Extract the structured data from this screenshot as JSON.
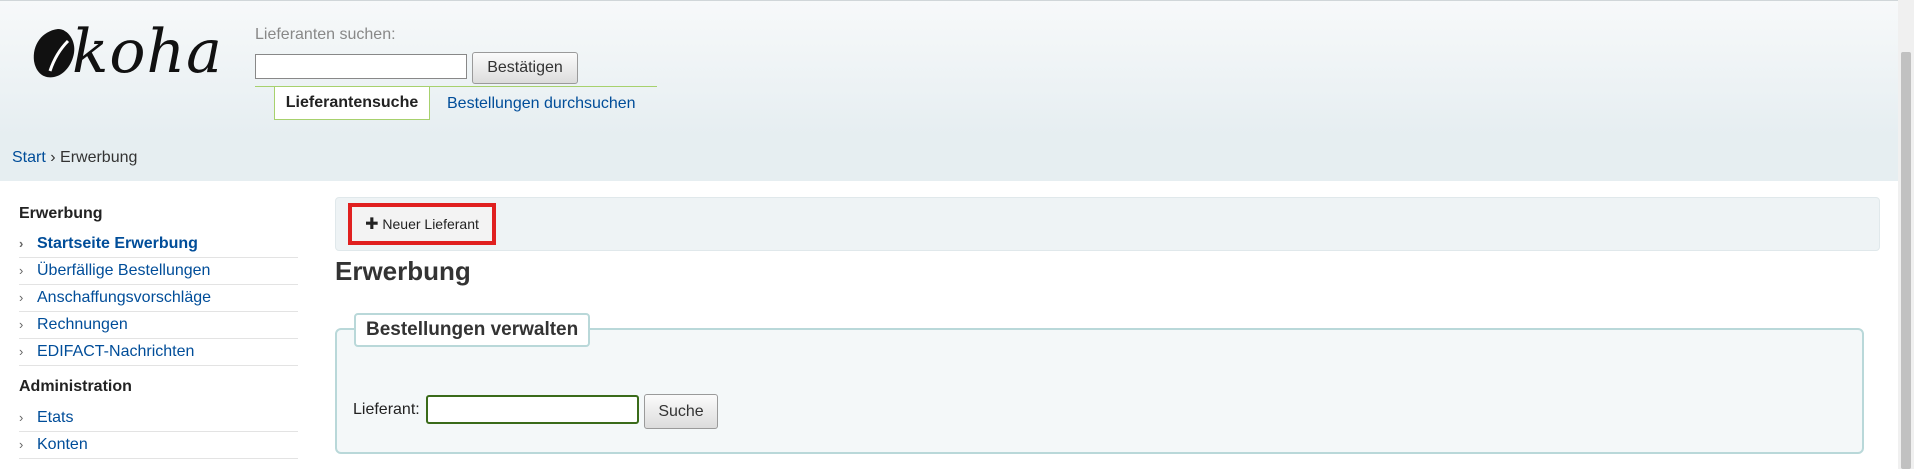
{
  "header": {
    "logo_text": "koha",
    "search_label": "Lieferanten suchen:",
    "search_value": "",
    "search_button": "Bestätigen",
    "tabs": [
      {
        "label": "Lieferantensuche",
        "active": true
      },
      {
        "label": "Bestellungen durchsuchen",
        "active": false
      }
    ]
  },
  "breadcrumb": {
    "home": "Start",
    "separator": " › ",
    "current": "Erwerbung"
  },
  "sidebar": {
    "sections": [
      {
        "heading": "Erwerbung",
        "items": [
          {
            "label": "Startseite Erwerbung",
            "current": true
          },
          {
            "label": "Überfällige Bestellungen"
          },
          {
            "label": "Anschaffungsvorschläge"
          },
          {
            "label": "Rechnungen"
          },
          {
            "label": "EDIFACT-Nachrichten"
          }
        ]
      },
      {
        "heading": "Administration",
        "items": [
          {
            "label": "Etats"
          },
          {
            "label": "Konten"
          }
        ]
      }
    ]
  },
  "toolbar": {
    "new_vendor_icon": "plus-icon",
    "new_vendor_label": "Neuer Lieferant"
  },
  "main": {
    "title": "Erwerbung",
    "manage_orders": {
      "legend": "Bestellungen verwalten",
      "vendor_label": "Lieferant:",
      "vendor_value": "",
      "search_button": "Suche"
    }
  },
  "colors": {
    "link": "#004d99",
    "header_bg": "#e6eef1",
    "tab_border": "#a7d16d",
    "highlight": "#e02020"
  }
}
